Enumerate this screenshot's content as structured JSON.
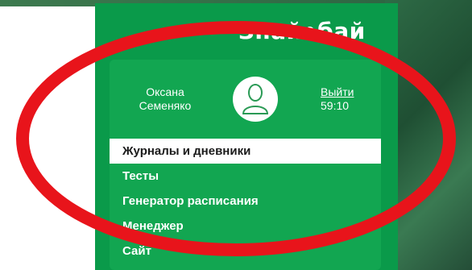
{
  "header": {
    "brand": "Знай•бай"
  },
  "user": {
    "first_name": "Оксана",
    "last_name": "Семеняко",
    "avatar_icon": "user-icon"
  },
  "session": {
    "logout_label": "Выйти",
    "timer": "59:10"
  },
  "menu": {
    "items": [
      {
        "label": "Журналы и дневники",
        "active": true
      },
      {
        "label": "Тесты",
        "active": false
      },
      {
        "label": "Генератор расписания",
        "active": false
      },
      {
        "label": "Менеджер",
        "active": false
      },
      {
        "label": "Сайт",
        "active": false
      }
    ]
  },
  "colors": {
    "panel": "#0a9a4a",
    "card": "#12a651",
    "highlight_oval": "#e8141b",
    "active_item_bg": "#ffffff"
  }
}
